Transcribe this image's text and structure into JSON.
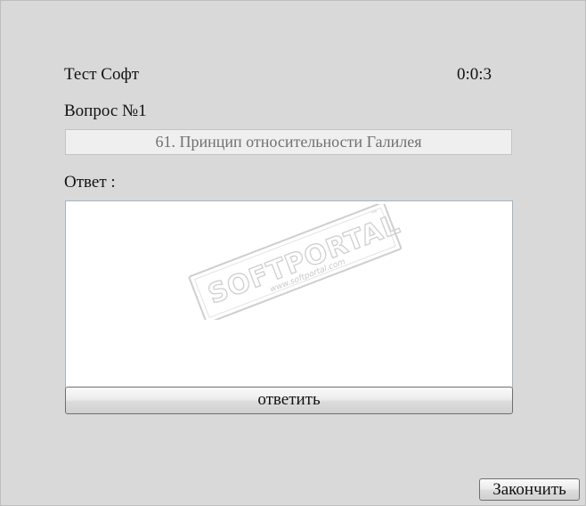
{
  "header": {
    "app_title": "Тест Софт",
    "timer": "0:0:3"
  },
  "question": {
    "label": "Вопрос №1",
    "text": "61. Принцип относительности Галилея"
  },
  "answer": {
    "label": "Ответ :",
    "value": ""
  },
  "buttons": {
    "submit_label": "ответить",
    "finish_label": "Закончить"
  },
  "watermark": {
    "brand": "SOFTPORTAL",
    "trademark": "™",
    "url": "www.softportal.com"
  }
}
